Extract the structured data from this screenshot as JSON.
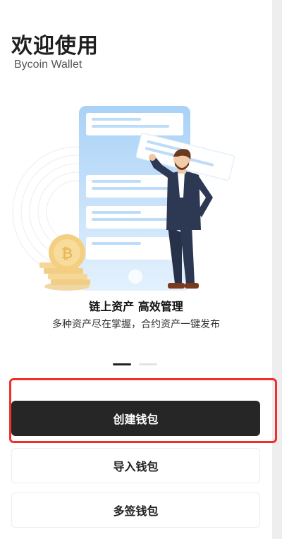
{
  "header": {
    "title": "欢迎使用",
    "subtitle": "Bycoin Wallet"
  },
  "slide": {
    "title": "链上资产 高效管理",
    "description": "多种资产尽在掌握，合约资产一键发布",
    "current_page": 1,
    "total_pages": 2
  },
  "actions": {
    "create_wallet": "创建钱包",
    "import_wallet": "导入钱包",
    "multisig_wallet": "多签钱包"
  },
  "colors": {
    "primary_button": "#262626",
    "highlight_border": "#f2302a"
  },
  "illustration": {
    "icons": [
      "coin-stack-icon",
      "phone-icon",
      "businessman-icon"
    ]
  }
}
